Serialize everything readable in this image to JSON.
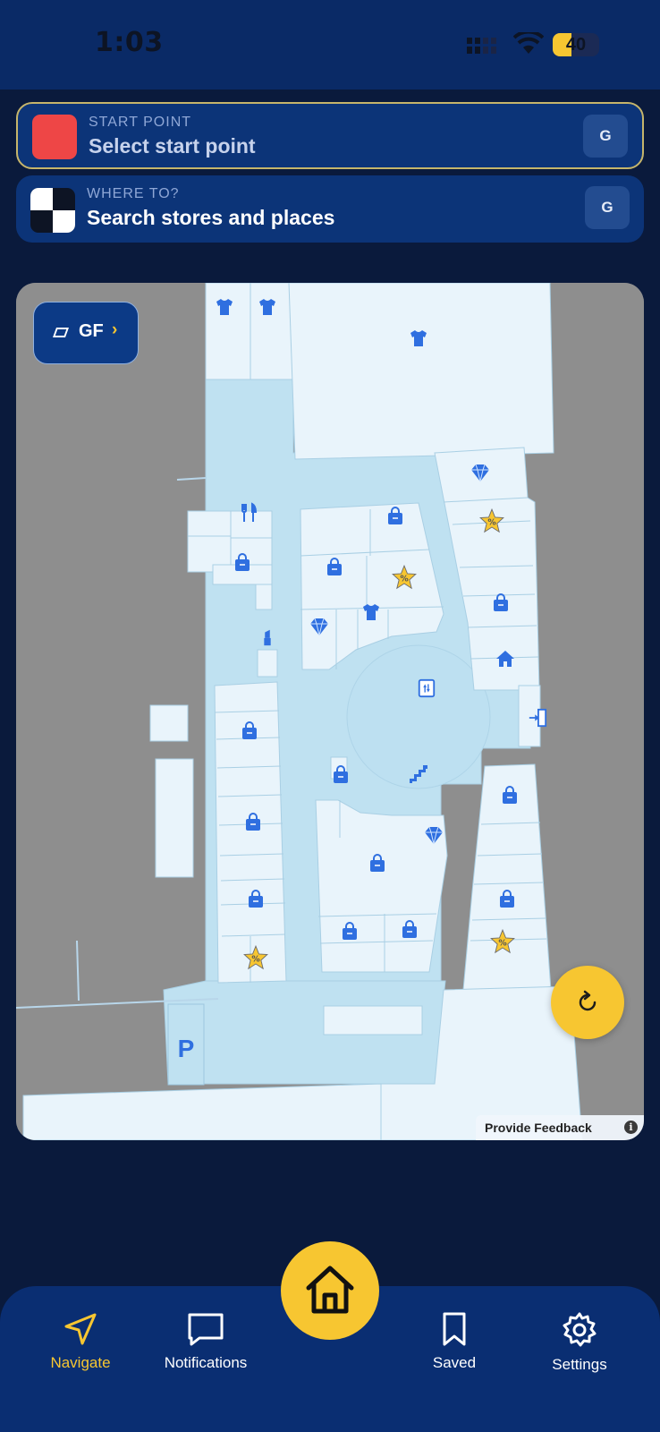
{
  "status": {
    "time": "1:03",
    "battery": "40",
    "battery_level": 0.4
  },
  "start": {
    "label": "START POINT",
    "title": "Select start point",
    "action": "G"
  },
  "destination": {
    "label": "WHERE TO?",
    "title": "Search stores and places",
    "action": "G"
  },
  "map": {
    "floor": "GF",
    "feedback": "Provide Feedback",
    "parking_label": "P"
  },
  "nav": {
    "navigate": "Navigate",
    "notifications": "Notifications",
    "saved": "Saved",
    "settings": "Settings"
  },
  "colors": {
    "accent": "#f7c631",
    "header": "#0a2a66",
    "background": "#0a1a3c",
    "start_marker": "#ee4646",
    "map_store": "#e9f4fb",
    "map_corridor": "#bfe1f1",
    "map_icon": "#2f6fe0"
  }
}
